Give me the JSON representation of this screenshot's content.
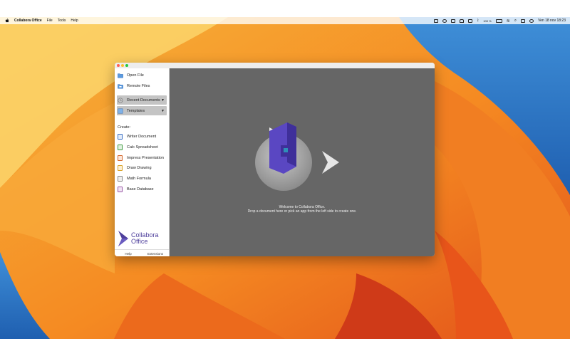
{
  "menubar": {
    "app_name": "Collabora Office",
    "menus": [
      "File",
      "Tools",
      "Help"
    ],
    "clock": "Ven 18 nov 18:23",
    "battery": "100 %"
  },
  "sidebar": {
    "open_file": "Open File",
    "remote_files": "Remote Files",
    "recent_documents": "Recent Documents",
    "templates": "Templates",
    "create_label": "Create:",
    "create_items": [
      "Writer Document",
      "Calc Spreadsheet",
      "Impress Presentation",
      "Draw Drawing",
      "Math Formula",
      "Base Database"
    ],
    "create_colors": [
      "#3b6fc4",
      "#3f9a3f",
      "#d4662a",
      "#d9a227",
      "#888888",
      "#9a5aa6"
    ],
    "help": "Help",
    "extensions": "Extensions"
  },
  "logo": {
    "line1": "Collabora",
    "line2": "Office"
  },
  "welcome": {
    "line1": "Welcome to Collabora Office.",
    "line2": "Drop a document here or pick an app from the left side to create one."
  },
  "colors": {
    "brand": "#4e3f9c",
    "main_bg": "#666666"
  }
}
